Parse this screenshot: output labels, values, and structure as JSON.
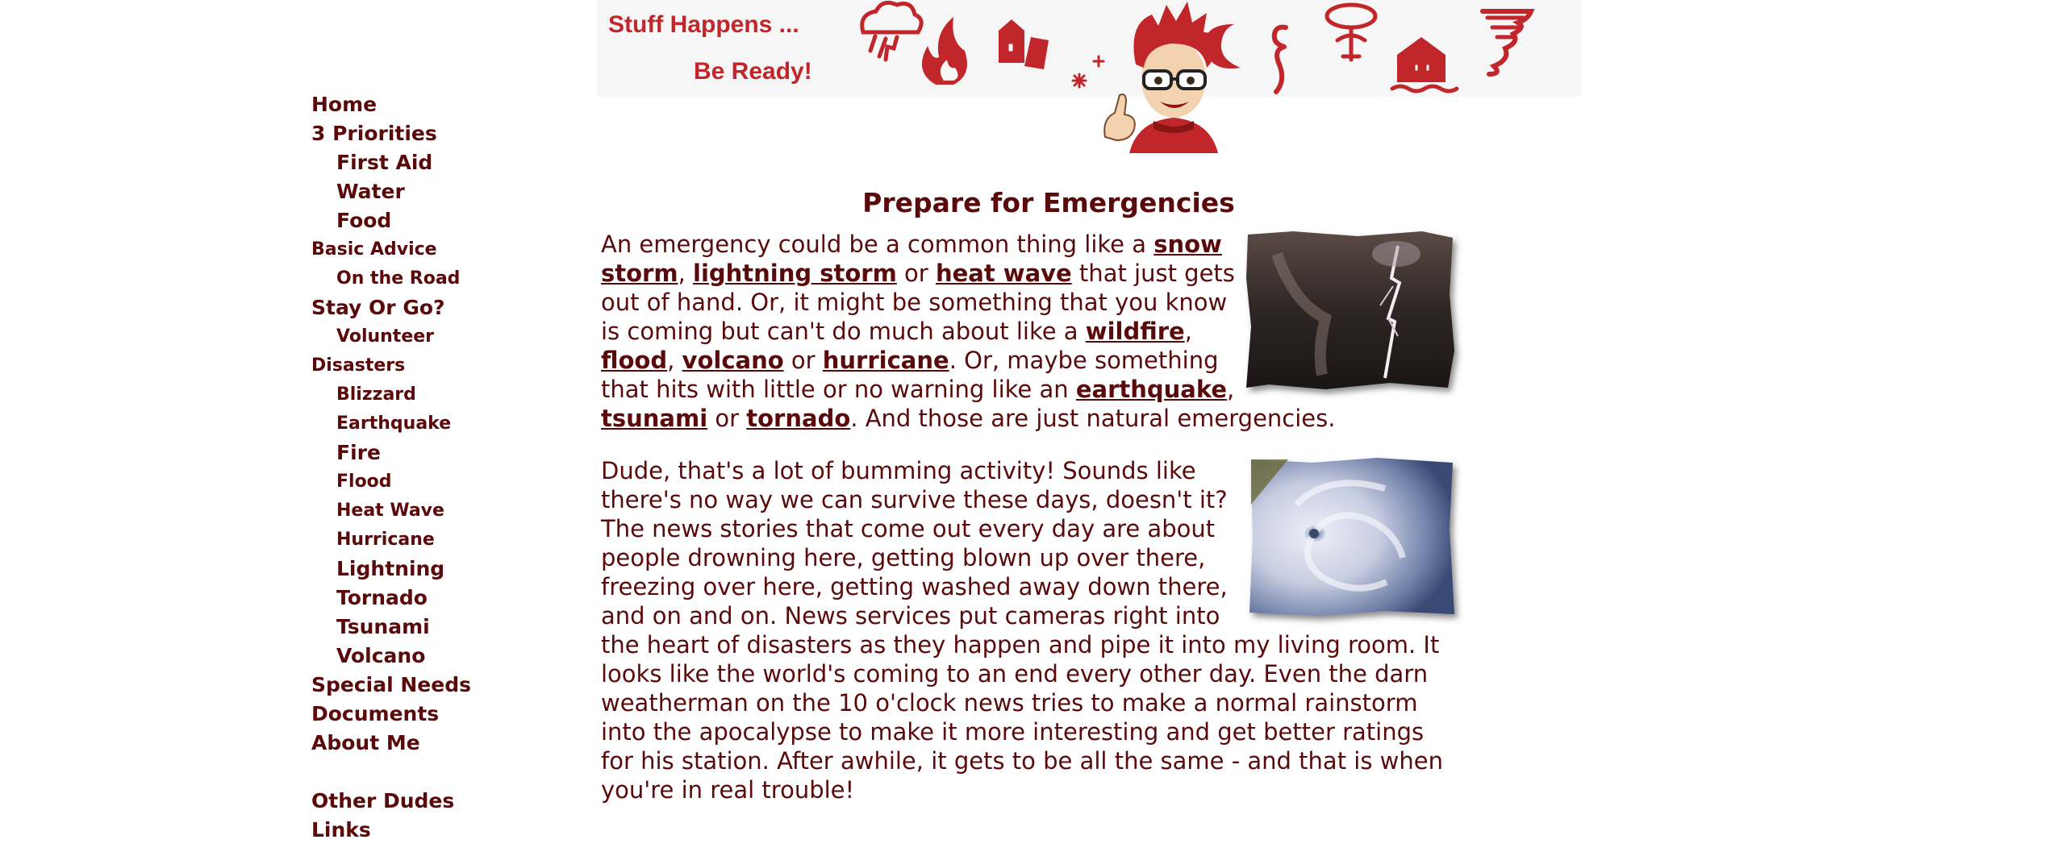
{
  "banner": {
    "tagline_1": "Stuff Happens ...",
    "tagline_2": "Be Ready!",
    "icons": [
      "storm-cloud-icon",
      "fire-icon",
      "houses-icon",
      "snowflake-icon",
      "moon-icon",
      "hurricane-symbol-icon",
      "nuclear-cloud-icon",
      "flooded-house-icon",
      "tornado-icon"
    ],
    "accent_color": "#c0262a"
  },
  "nav": {
    "items": [
      {
        "label": "Home"
      },
      {
        "label": "3 Priorities"
      },
      {
        "label": "First Aid"
      },
      {
        "label": "Water"
      },
      {
        "label": "Food"
      },
      {
        "label": "Basic Advice"
      },
      {
        "label": "On the Road"
      },
      {
        "label": "Stay Or Go?"
      },
      {
        "label": "Volunteer"
      },
      {
        "label": "Disasters"
      },
      {
        "label": "Blizzard"
      },
      {
        "label": "Earthquake"
      },
      {
        "label": "Fire"
      },
      {
        "label": "Flood"
      },
      {
        "label": "Heat Wave"
      },
      {
        "label": "Hurricane"
      },
      {
        "label": "Lightning"
      },
      {
        "label": "Tornado"
      },
      {
        "label": "Tsunami"
      },
      {
        "label": "Volcano"
      },
      {
        "label": "Special Needs"
      },
      {
        "label": "Documents"
      },
      {
        "label": "About Me"
      },
      {
        "label": "Other Dudes"
      },
      {
        "label": "Links"
      }
    ]
  },
  "main": {
    "title": "Prepare for Emergencies",
    "p1": {
      "t1": "An emergency could be a common thing like a ",
      "l_snow": "snow storm",
      "t2": ", ",
      "l_lightning": "lightning storm",
      "t3": " or ",
      "l_heat": "heat wave",
      "t4": " that just gets out of hand. Or, it might be something that you know is coming but can't do much about like a ",
      "l_wildfire": "wildfire",
      "t5": ", ",
      "l_flood": "flood",
      "t6": ", ",
      "l_volcano": "volcano",
      "t7": " or ",
      "l_hurricane": "hurricane",
      "t8": ". Or, maybe something that hits with little or no warning like an ",
      "l_earthquake": "earthquake",
      "t9": ", ",
      "l_tsunami": "tsunami",
      "t10": " or ",
      "l_tornado": "tornado",
      "t11": ". And those are just natural emergencies."
    },
    "p2": "Dude, that's a lot of bumming activity! Sounds like there's no way we can survive these days, doesn't it? The news stories that come out every day are about people drowning here, getting blown up over there, freezing over here, getting washed away down there, and on and on. News services put cameras right into the heart of disasters as they happen and pipe it into my living room. It looks like the world's coming to an end every other day. Even the darn weatherman on the 10 o'clock news tries to make a normal rainstorm into the apocalypse to make it more interesting and get better ratings for his station. After awhile, it gets to be all the same - and that is when you're in real trouble!"
  },
  "colors": {
    "text": "#5a0a0a",
    "background": "#ffffff"
  }
}
